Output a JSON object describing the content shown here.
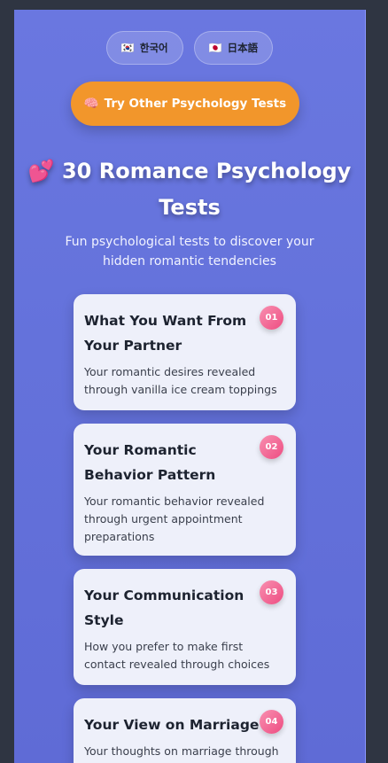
{
  "languages": [
    {
      "flag": "🇰🇷",
      "label": "한국어"
    },
    {
      "flag": "🇯🇵",
      "label": "日本語"
    }
  ],
  "cta": {
    "icon": "🧠",
    "label": "Try Other Psychology Tests"
  },
  "header": {
    "emoji": "💕",
    "title": "30 Romance Psychology Tests",
    "subtitle": "Fun psychological tests to discover your hidden romantic tendencies"
  },
  "tests": [
    {
      "number": "01",
      "title": "What You Want From Your Partner",
      "description": "Your romantic desires revealed through vanilla ice cream toppings"
    },
    {
      "number": "02",
      "title": "Your Romantic Behavior Pattern",
      "description": "Your romantic behavior revealed through urgent appointment preparations"
    },
    {
      "number": "03",
      "title": "Your Communication Style",
      "description": "How you prefer to make first contact revealed through choices"
    },
    {
      "number": "04",
      "title": "Your View on Marriage",
      "description": "Your thoughts on marriage through"
    }
  ]
}
